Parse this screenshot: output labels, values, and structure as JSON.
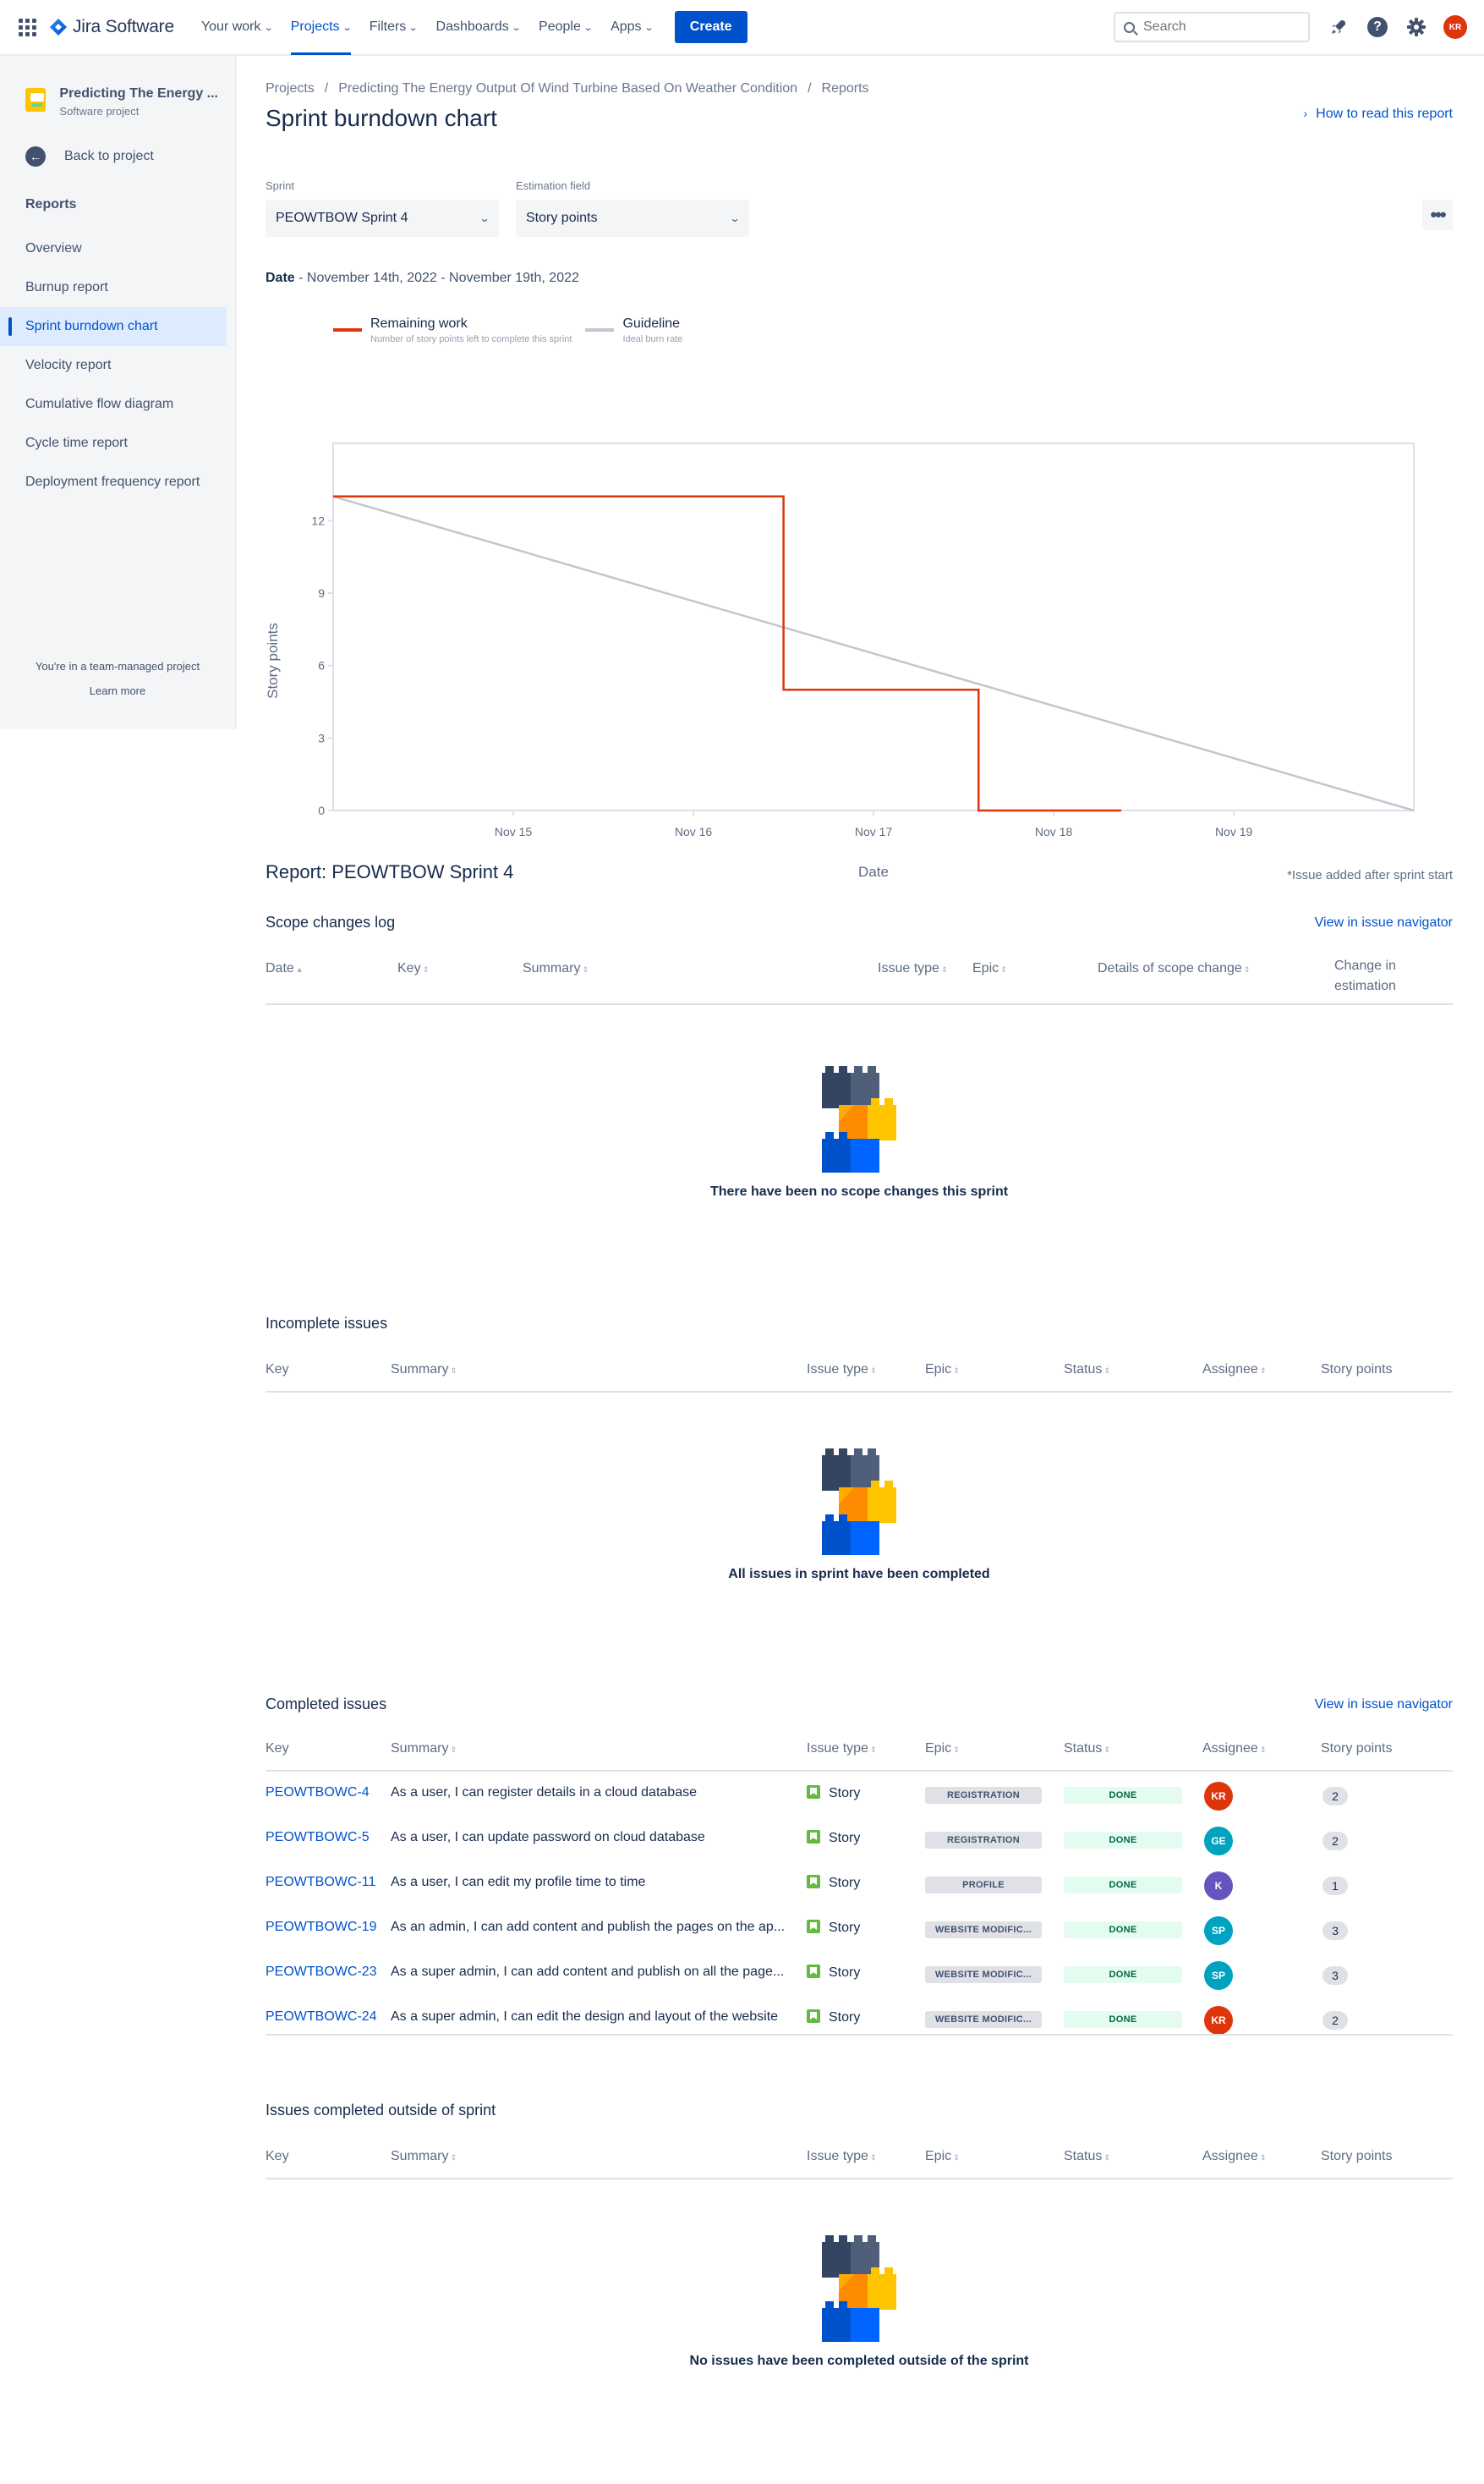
{
  "topnav": {
    "app_name": "Jira Software",
    "items": [
      {
        "label": "Your work"
      },
      {
        "label": "Projects"
      },
      {
        "label": "Filters"
      },
      {
        "label": "Dashboards"
      },
      {
        "label": "People"
      },
      {
        "label": "Apps"
      }
    ],
    "create_label": "Create",
    "search_placeholder": "Search",
    "user_initials": "KR"
  },
  "sidebar": {
    "project_name": "Predicting The Energy ...",
    "project_type": "Software project",
    "back_label": "Back to project",
    "heading": "Reports",
    "items": [
      {
        "label": "Overview"
      },
      {
        "label": "Burnup report"
      },
      {
        "label": "Sprint burndown chart"
      },
      {
        "label": "Velocity report"
      },
      {
        "label": "Cumulative flow diagram"
      },
      {
        "label": "Cycle time report"
      },
      {
        "label": "Deployment frequency report"
      }
    ],
    "footer_text": "You're in a team-managed project",
    "footer_link": "Learn more"
  },
  "header": {
    "breadcrumb": [
      "Projects",
      "Predicting The Energy Output Of Wind Turbine Based On Weather Condition",
      "Reports"
    ],
    "title": "Sprint burndown chart",
    "how_link": "How to read this report"
  },
  "filters": {
    "sprint_label": "Sprint",
    "sprint_value": "PEOWTBOW Sprint 4",
    "estimation_label": "Estimation field",
    "estimation_value": "Story points"
  },
  "date_line": {
    "label": "Date",
    "value": "- November 14th, 2022 - November 19th, 2022"
  },
  "legend": [
    {
      "title": "Remaining work",
      "sub": "Number of story points left to complete this sprint",
      "color": "#de350b"
    },
    {
      "title": "Guideline",
      "sub": "Ideal burn rate",
      "color": "#c1c7d0"
    }
  ],
  "chart_data": {
    "type": "line",
    "xlabel": "Date",
    "ylabel": "Story points",
    "x_ticks": [
      "Nov 15",
      "Nov 16",
      "Nov 17",
      "Nov 18",
      "Nov 19"
    ],
    "y_ticks": [
      0,
      3,
      6,
      9,
      12
    ],
    "ylim": [
      0,
      15.2
    ],
    "xlim_days": [
      "2022-11-14",
      "2022-11-19T23:59"
    ],
    "grid": false,
    "series": [
      {
        "name": "Remaining work",
        "step": true,
        "points": [
          {
            "x": "2022-11-14T00:00",
            "y": 13
          },
          {
            "x": "2022-11-16T12:00",
            "y": 13
          },
          {
            "x": "2022-11-16T12:00",
            "y": 5
          },
          {
            "x": "2022-11-17T14:00",
            "y": 5
          },
          {
            "x": "2022-11-17T14:00",
            "y": 0
          },
          {
            "x": "2022-11-18T09:00",
            "y": 0
          }
        ]
      },
      {
        "name": "Guideline",
        "points": [
          {
            "x": "2022-11-14T00:00",
            "y": 13
          },
          {
            "x": "2022-11-19T23:59",
            "y": 0
          }
        ]
      }
    ]
  },
  "report": {
    "title": "Report: PEOWTBOW Sprint 4",
    "note": "*Issue added after sprint start"
  },
  "scope": {
    "title": "Scope changes log",
    "link": "View in issue navigator",
    "columns": [
      "Date",
      "Key",
      "Summary",
      "Issue type",
      "Epic",
      "Details of scope change",
      "Change in",
      "estimation"
    ],
    "empty": "There have been no scope changes this sprint"
  },
  "incomplete": {
    "title": "Incomplete issues",
    "columns": [
      "Key",
      "Summary",
      "Issue type",
      "Epic",
      "Status",
      "Assignee",
      "Story points"
    ],
    "empty": "All issues in sprint have been completed"
  },
  "completed": {
    "title": "Completed issues",
    "link": "View in issue navigator",
    "columns": [
      "Key",
      "Summary",
      "Issue type",
      "Epic",
      "Status",
      "Assignee",
      "Story points"
    ],
    "rows": [
      {
        "key": "PEOWTBOWC-4",
        "summary": "As a user, I can register details in a cloud database",
        "type": "Story",
        "epic": "REGISTRATION",
        "status": "DONE",
        "assignee": "KR",
        "assignee_color": "#de350b",
        "points": "2"
      },
      {
        "key": "PEOWTBOWC-5",
        "summary": "As a user, I can update password on cloud database",
        "type": "Story",
        "epic": "REGISTRATION",
        "status": "DONE",
        "assignee": "GE",
        "assignee_color": "#00a3bf",
        "points": "2"
      },
      {
        "key": "PEOWTBOWC-11",
        "summary": "As a user, I can edit my profile time to time",
        "type": "Story",
        "epic": "PROFILE",
        "status": "DONE",
        "assignee": "K",
        "assignee_color": "#6554c0",
        "points": "1"
      },
      {
        "key": "PEOWTBOWC-19",
        "summary": "As an admin, I can add content and publish the pages on the ap...",
        "type": "Story",
        "epic": "WEBSITE MODIFIC...",
        "status": "DONE",
        "assignee": "SP",
        "assignee_color": "#00a3bf",
        "points": "3"
      },
      {
        "key": "PEOWTBOWC-23",
        "summary": "As a super admin, I can add content and publish on all the page...",
        "type": "Story",
        "epic": "WEBSITE MODIFIC...",
        "status": "DONE",
        "assignee": "SP",
        "assignee_color": "#00a3bf",
        "points": "3"
      },
      {
        "key": "PEOWTBOWC-24",
        "summary": "As a super admin, I can edit the design and layout of the website",
        "type": "Story",
        "epic": "WEBSITE MODIFIC...",
        "status": "DONE",
        "assignee": "KR",
        "assignee_color": "#de350b",
        "points": "2"
      }
    ]
  },
  "outside": {
    "title": "Issues completed outside of sprint",
    "columns": [
      "Key",
      "Summary",
      "Issue type",
      "Epic",
      "Status",
      "Assignee",
      "Story points"
    ],
    "empty": "No issues have been completed outside of the sprint"
  }
}
